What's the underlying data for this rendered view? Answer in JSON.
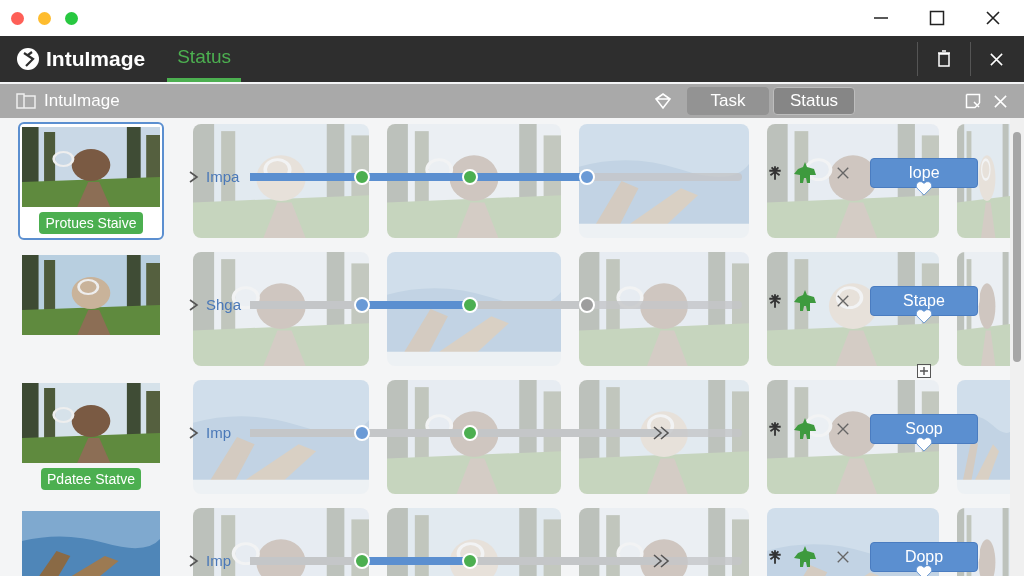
{
  "app": {
    "name": "IntuImage",
    "tabs": [
      {
        "label": "Status",
        "selected": true
      }
    ]
  },
  "toolbar": {
    "title": "IntuImage",
    "tabs": [
      {
        "label": "Task",
        "selected": false
      },
      {
        "label": "Status",
        "selected": true
      }
    ]
  },
  "rows": [
    {
      "selected": true,
      "badge": "Protues Staive",
      "label": "Impa",
      "markers": [
        {
          "kind": "dot",
          "color": "#4caf50",
          "filled": true
        },
        {
          "kind": "dot",
          "color": "#4caf50",
          "filled": true
        },
        {
          "kind": "dot",
          "color": "#6a9ad6",
          "filled": true
        }
      ],
      "button": "Iope",
      "add": false
    },
    {
      "selected": false,
      "label": "Shga",
      "markers": [
        {
          "kind": "dot",
          "color": "#6a9ad6",
          "filled": false
        },
        {
          "kind": "dot",
          "color": "#4caf50",
          "filled": true
        },
        {
          "kind": "dot",
          "color": "#9e9e9e",
          "filled": false
        }
      ],
      "button": "Stape",
      "add": true
    },
    {
      "selected": false,
      "badge": "Pdatee Statve",
      "label": "Imp",
      "markers": [
        {
          "kind": "dot",
          "color": "#6a9ad6",
          "filled": false
        },
        {
          "kind": "dot",
          "color": "#4caf50",
          "filled": false
        },
        {
          "kind": "chevron",
          "filled": false
        }
      ],
      "button": "Soop",
      "add": false
    },
    {
      "selected": false,
      "label": "Imp",
      "markers": [
        {
          "kind": "dot",
          "color": "#4caf50",
          "filled": false
        },
        {
          "kind": "dot",
          "color": "#4caf50",
          "filled": true
        },
        {
          "kind": "chevron",
          "filled": false
        }
      ],
      "button": "Dopp",
      "add": false
    }
  ]
}
